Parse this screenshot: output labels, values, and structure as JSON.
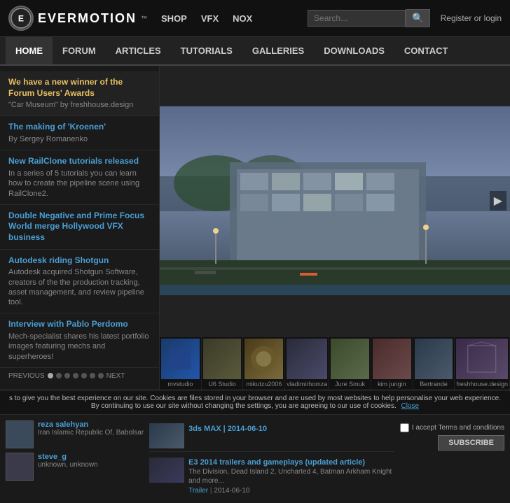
{
  "header": {
    "logo_text": "EVERMOTION",
    "logo_tm": "™",
    "logo_circle": "E",
    "nav": [
      "SHOP",
      "VFX",
      "NOX"
    ],
    "search_placeholder": "Search...",
    "auth_text": "Register or login"
  },
  "main_nav": {
    "items": [
      "HOME",
      "FORUM",
      "ARTICLES",
      "TUTORIALS",
      "GALLERIES",
      "DOWNLOADS",
      "CONTACT"
    ],
    "active": "HOME"
  },
  "sidebar": {
    "items": [
      {
        "headline": "We have a new winner of the Forum Users' Awards",
        "subtext": "\"Car Museum\" by freshhouse.design",
        "type": "highlight"
      },
      {
        "headline": "The making of 'Kroenen'",
        "author": "By Sergey Romanenko",
        "subtext": ""
      },
      {
        "headline": "New RailClone tutorials released",
        "subtext": "In a series of 5 tutorials you can learn how to create the pipeline scene using RailClone2."
      },
      {
        "headline": "Double Negative and Prime Focus World merge Hollywood VFX business",
        "subtext": ""
      },
      {
        "headline": "Autodesk riding Shotgun",
        "subtext": "Autodesk acquired Shotgun Software, creators of the the production tracking, asset management, and review pipeline tool."
      },
      {
        "headline": "Interview with Pablo Perdomo",
        "subtext": "Mech-specialist shares his latest portfolio images featuring mechs and superheroes!"
      }
    ],
    "prev_label": "PREVIOUS",
    "next_label": "NEXT",
    "dots": 7
  },
  "thumbnails": [
    {
      "label": "mvstudio",
      "color": "t1"
    },
    {
      "label": "U6 Studio",
      "color": "t2"
    },
    {
      "label": "mikutzu2006",
      "color": "t3"
    },
    {
      "label": "vladimirhomza",
      "color": "t4"
    },
    {
      "label": "Jure Smuk",
      "color": "t5"
    },
    {
      "label": "kim jungin",
      "color": "t6"
    },
    {
      "label": "Bertrande",
      "color": "t7"
    },
    {
      "label": "freshhouse.design",
      "color": "t8"
    }
  ],
  "cookie_bar": {
    "text": "s to give you the best experience on our site. Cookies are files stored in your browser and are used by most websites to help personalise your web experience. By continuing to use our site without changing the settings, you are agreeing to our use of cookies.",
    "close_label": "Close"
  },
  "bottom": {
    "users": [
      {
        "name": "reza salehyan",
        "location": "Iran Islamic Republic Of, Babolsar"
      },
      {
        "name": "steve_g",
        "location": "unknown, unknown"
      }
    ],
    "news": [
      {
        "headline": "3ds MAX  |  2014-06-10",
        "type": "tag"
      },
      {
        "headline": "E3 2014 trailers and gameplays (updated article)",
        "subtext": "The Division, Dead Island 2, Uncharted 4, Batman Arkham Knight and more...",
        "tag": "Trailer",
        "date": "2014-06-10"
      }
    ],
    "subscribe": {
      "checkbox_label": "I accept Terms and conditions",
      "button_label": "SUBSCRIBE"
    }
  }
}
